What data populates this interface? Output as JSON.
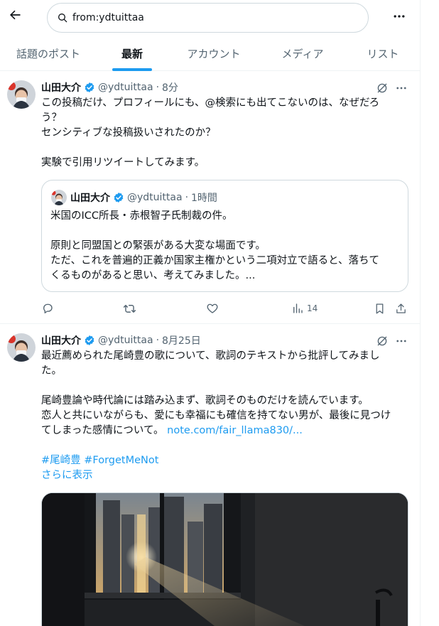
{
  "search": {
    "value": "from:ydtuittaa"
  },
  "tabs": [
    {
      "label": "話題のポスト",
      "active": false
    },
    {
      "label": "最新",
      "active": true
    },
    {
      "label": "アカウント",
      "active": false
    },
    {
      "label": "メディア",
      "active": false
    },
    {
      "label": "リスト",
      "active": false
    }
  ],
  "tweets": [
    {
      "name": "山田大介",
      "handle": "@ydtuittaa",
      "dot": "·",
      "time": "8分",
      "lines": [
        "この投稿だけ、プロフィールにも、@検索にも出てこないのは、なぜだろ",
        "う？",
        "センシティブな投稿扱いされたのか？",
        "",
        "実験で引用リツイートしてみます。"
      ],
      "quote": {
        "name": "山田大介",
        "handle": "@ydtuittaa",
        "dot": "·",
        "time": "1時間",
        "lines": [
          "米国のICC所長・赤根智子氏制裁の件。",
          "",
          "原則と同盟国との緊張がある大変な場面です。",
          "ただ、これを普遍的正義か国家主権かという二項対立で語ると、落ちて",
          "くるものがあると思い、考えてみました。..."
        ]
      },
      "views": "14"
    },
    {
      "name": "山田大介",
      "handle": "@ydtuittaa",
      "dot": "·",
      "time": "8月25日",
      "lines": [
        "最近薦められた尾崎豊の歌について、歌詞のテキストから批評してみまし",
        "た。",
        "",
        "尾崎豊論や時代論には踏み込まず、歌詞そのものだけを読んでいます。",
        "恋人と共にいながらも、愛にも幸福にも確信を持てない男が、最後に見つけ",
        "てしまった感情について。"
      ],
      "link": "note.com/fair_llama830/...",
      "hashtags": "#尾崎豊 #ForgetMeNot",
      "show_more": "さらに表示"
    }
  ],
  "colors": {
    "accent": "#1d9bf0",
    "text": "#0f1419",
    "muted": "#536471",
    "border": "#eff3f4"
  },
  "icons": [
    "back-arrow-icon",
    "search-icon",
    "more-icon",
    "verified-badge-icon",
    "grok-icon",
    "reply-icon",
    "retweet-icon",
    "like-icon",
    "views-icon",
    "bookmark-icon",
    "share-icon"
  ]
}
